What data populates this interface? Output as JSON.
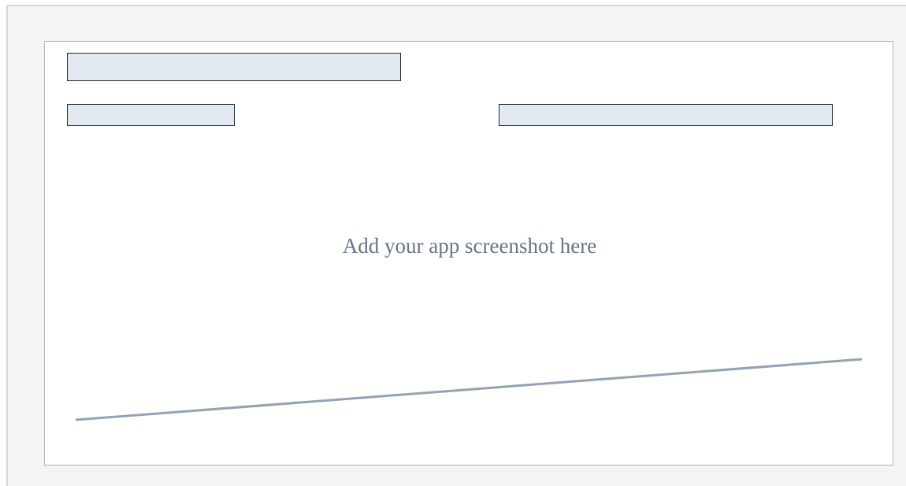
{
  "placeholder": {
    "message": "Add your app screenshot here"
  },
  "colors": {
    "outer_background": "#f4f4f5",
    "panel_background": "#ffffff",
    "panel_border": "#a8b6c6",
    "bar_fill": "#e2e8f0",
    "bar_border": "#1f2933",
    "message_text": "#64758b",
    "line_stroke": "#94a3b4"
  }
}
